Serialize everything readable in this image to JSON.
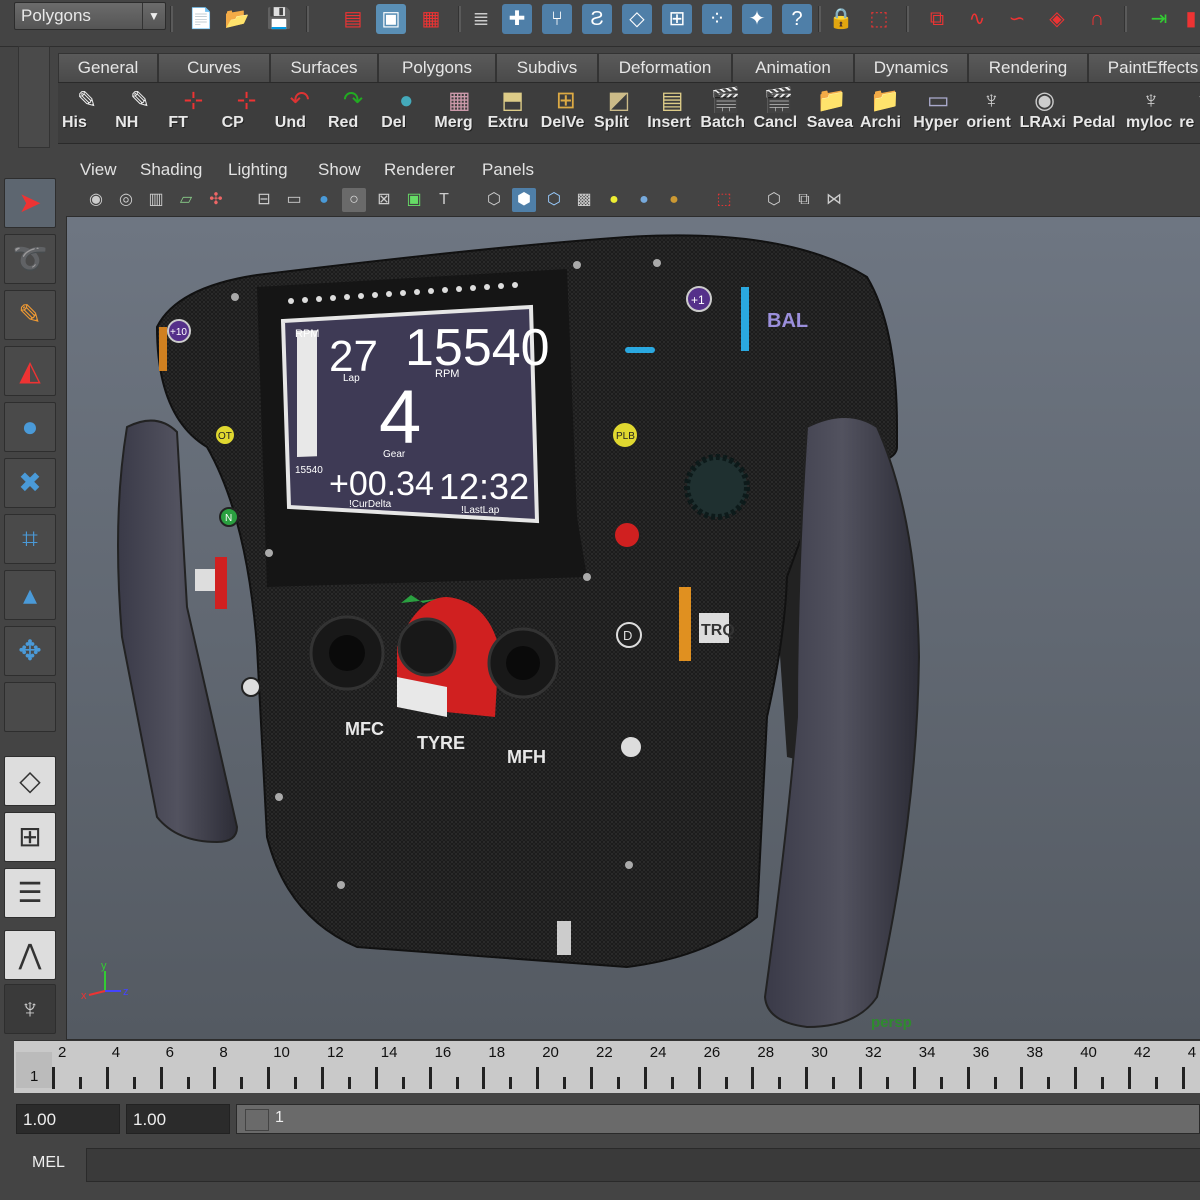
{
  "status_line": {
    "menu_set": "Polygons",
    "icons": [
      "new-scene-icon",
      "open-scene-icon",
      "save-scene-icon",
      "select-hierarchy-icon",
      "select-object-icon",
      "select-component-icon",
      "snap-grid-icon",
      "snap-curve-icon",
      "snap-point-icon",
      "snap-plane-icon",
      "snap-surface-icon",
      "snap-live-icon",
      "soft-select-icon",
      "history-icon",
      "help-icon",
      "lock-icon",
      "input-output-icon",
      "render-icon",
      "ipr-icon",
      "render-settings-icon",
      "hypershade-icon",
      "magnet-icon",
      "channel-box-icon"
    ]
  },
  "shelf": {
    "tabs": [
      "General",
      "Curves",
      "Surfaces",
      "Polygons",
      "Subdivs",
      "Deformation",
      "Animation",
      "Dynamics",
      "Rendering",
      "PaintEffects"
    ],
    "buttons": [
      {
        "label": "His",
        "icon": "pencil-icon"
      },
      {
        "label": "NH",
        "icon": "pencil-icon"
      },
      {
        "label": "FT",
        "icon": "axis-icon"
      },
      {
        "label": "CP",
        "icon": "axis-icon"
      },
      {
        "label": "Und",
        "icon": "undo-arrow-icon"
      },
      {
        "label": "Red",
        "icon": "redo-arrow-icon"
      },
      {
        "label": "Del",
        "icon": "sphere-icon"
      },
      {
        "label": "Merg",
        "icon": "mesh-icon"
      },
      {
        "label": "Extru",
        "icon": "extrude-icon"
      },
      {
        "label": "DelVe",
        "icon": "mesh-vertex-icon"
      },
      {
        "label": "Split",
        "icon": "split-icon"
      },
      {
        "label": "Insert",
        "icon": "insert-edge-icon"
      },
      {
        "label": "Batch",
        "icon": "clapper-icon"
      },
      {
        "label": "Cancl",
        "icon": "clapper-icon"
      },
      {
        "label": "Savea",
        "icon": "folder-icon"
      },
      {
        "label": "Archi",
        "icon": "folder-icon"
      },
      {
        "label": "Hyper",
        "icon": "window-icon"
      },
      {
        "label": "orient",
        "icon": "script-icon"
      },
      {
        "label": "LRAxi",
        "icon": "eye-icon"
      },
      {
        "label": "Pedal",
        "icon": "blank-icon"
      },
      {
        "label": "myloc",
        "icon": "script-icon"
      },
      {
        "label": "re",
        "icon": "script-icon"
      }
    ]
  },
  "toolbox": [
    "select-tool-icon",
    "lasso-tool-icon",
    "paint-select-icon",
    "move-tool-icon",
    "rotate-tool-icon",
    "scale-tool-icon",
    "manipulator-icon",
    "soft-mod-icon",
    "last-tool-icon",
    "empty-slot",
    "single-perspective-icon",
    "four-view-icon",
    "persp-outliner-icon",
    "graph-editor-layout-icon",
    "maya-logo-icon"
  ],
  "panel": {
    "menus": [
      "View",
      "Shading",
      "Lighting",
      "Show",
      "Renderer",
      "Panels"
    ],
    "camera": "persp"
  },
  "dashboard": {
    "rpm_label": "RPM",
    "lap_value": "27",
    "lap_label": "Lap",
    "rpm_value": "15540",
    "rpm_unit": "RPM",
    "gear_value": "4",
    "gear_label": "Gear",
    "bar_label": "15540",
    "delta_value": "+00.34",
    "delta_label": "!CurDelta",
    "lastlap_value": "12:32",
    "lastlap_label": "!LastLap"
  },
  "wheel_labels": {
    "mfc": "MFC",
    "tyre": "TYRE",
    "mfh": "MFH",
    "bal": "BAL",
    "tro": "TRQ",
    "plus1": "+1",
    "plus10": "+10",
    "pl": "PLB",
    "ot": "OT",
    "n": "N",
    "d": "D"
  },
  "time_slider": {
    "current_frame": "1",
    "ticks": [
      "2",
      "4",
      "6",
      "8",
      "10",
      "12",
      "14",
      "16",
      "18",
      "20",
      "22",
      "24",
      "26",
      "28",
      "30",
      "32",
      "34",
      "36",
      "38",
      "40",
      "42",
      "4"
    ]
  },
  "range_slider": {
    "start": "1.00",
    "current": "1.00",
    "range_label": "1"
  },
  "command_line": {
    "mode": "MEL",
    "value": ""
  },
  "colors": {
    "viewport_top": "#6e7682",
    "viewport_bottom": "#545a62",
    "camera_label": "#2e8b2e"
  }
}
